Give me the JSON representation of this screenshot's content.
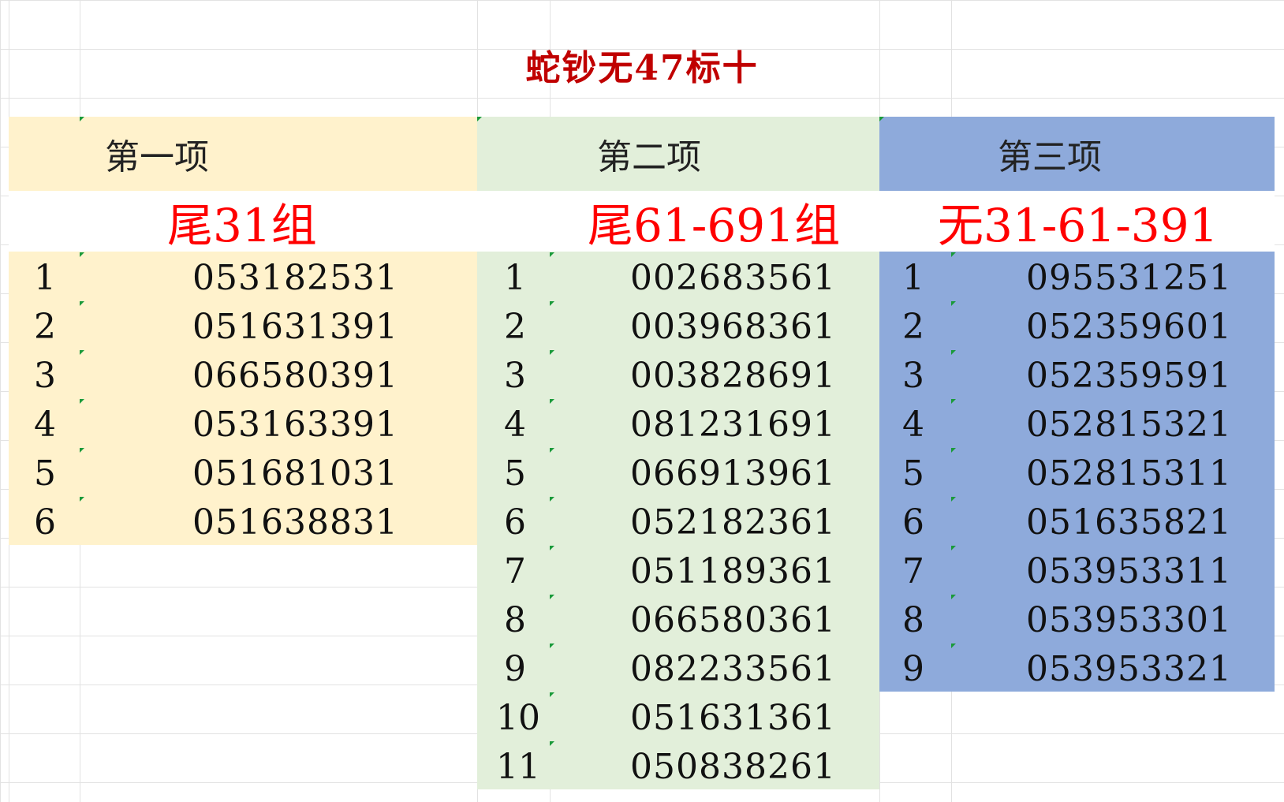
{
  "title": "蛇钞无47标十",
  "colors": {
    "title": "#c00000",
    "subtitle": "#ff0000",
    "col1_bg": "#fff2cc",
    "col2_bg": "#e2efda",
    "col3_bg": "#8eaadb"
  },
  "columns": [
    {
      "header": "第一项",
      "subtitle": "尾31组",
      "rows": [
        {
          "idx": "1",
          "val": "053182531"
        },
        {
          "idx": "2",
          "val": "051631391"
        },
        {
          "idx": "3",
          "val": "066580391"
        },
        {
          "idx": "4",
          "val": "053163391"
        },
        {
          "idx": "5",
          "val": "051681031"
        },
        {
          "idx": "6",
          "val": "051638831"
        }
      ]
    },
    {
      "header": "第二项",
      "subtitle": "尾61-691组",
      "rows": [
        {
          "idx": "1",
          "val": "002683561"
        },
        {
          "idx": "2",
          "val": "003968361"
        },
        {
          "idx": "3",
          "val": "003828691"
        },
        {
          "idx": "4",
          "val": "081231691"
        },
        {
          "idx": "5",
          "val": "066913961"
        },
        {
          "idx": "6",
          "val": "052182361"
        },
        {
          "idx": "7",
          "val": "051189361"
        },
        {
          "idx": "8",
          "val": "066580361"
        },
        {
          "idx": "9",
          "val": "082233561"
        },
        {
          "idx": "10",
          "val": "051631361"
        },
        {
          "idx": "11",
          "val": "050838261"
        }
      ]
    },
    {
      "header": "第三项",
      "subtitle": "无31-61-391",
      "rows": [
        {
          "idx": "1",
          "val": "095531251"
        },
        {
          "idx": "2",
          "val": "052359601"
        },
        {
          "idx": "3",
          "val": "052359591"
        },
        {
          "idx": "4",
          "val": "052815321"
        },
        {
          "idx": "5",
          "val": "052815311"
        },
        {
          "idx": "6",
          "val": "051635821"
        },
        {
          "idx": "7",
          "val": "053953311"
        },
        {
          "idx": "8",
          "val": "053953301"
        },
        {
          "idx": "9",
          "val": "053953321"
        }
      ]
    }
  ]
}
